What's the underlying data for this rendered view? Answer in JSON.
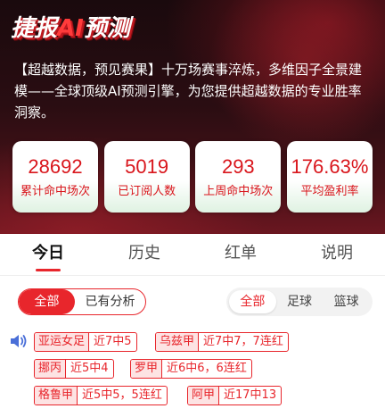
{
  "hero": {
    "title_before": "捷报",
    "title_ai": "AI",
    "title_after": "预测",
    "description": "【超越数据，预见赛果】十万场赛事淬炼，多维因子全景建模——全球顶级AI预测引擎，为您提供超越数据的专业胜率洞察。"
  },
  "stats": [
    {
      "value": "28692",
      "label": "累计命中场次"
    },
    {
      "value": "5019",
      "label": "已订阅人数"
    },
    {
      "value": "293",
      "label": "上周命中场次"
    },
    {
      "value": "176.63%",
      "label": "平均盈利率"
    }
  ],
  "tabs": [
    {
      "label": "今日",
      "active": true
    },
    {
      "label": "历史",
      "active": false
    },
    {
      "label": "红单",
      "active": false
    },
    {
      "label": "说明",
      "active": false
    }
  ],
  "filter_left": {
    "all": "全部",
    "analyzed": "已有分析"
  },
  "filter_right": {
    "all": "全部",
    "football": "足球",
    "basketball": "篮球"
  },
  "ticker": {
    "icon": "speaker-icon",
    "items": [
      {
        "league": "亚运女足",
        "record": "近7中5"
      },
      {
        "league": "乌兹甲",
        "record": "近7中7，7连红"
      },
      {
        "league": "挪丙",
        "record": "近5中4"
      },
      {
        "league": "罗甲",
        "record": "近6中6，6连红"
      },
      {
        "league": "格鲁甲",
        "record": "近5中5，5连红"
      },
      {
        "league": "阿甲",
        "record": "近17中13"
      }
    ]
  },
  "colors": {
    "accent": "#e8262c",
    "hero_bg": "#2a0d12",
    "stat_text": "#d9161c"
  }
}
